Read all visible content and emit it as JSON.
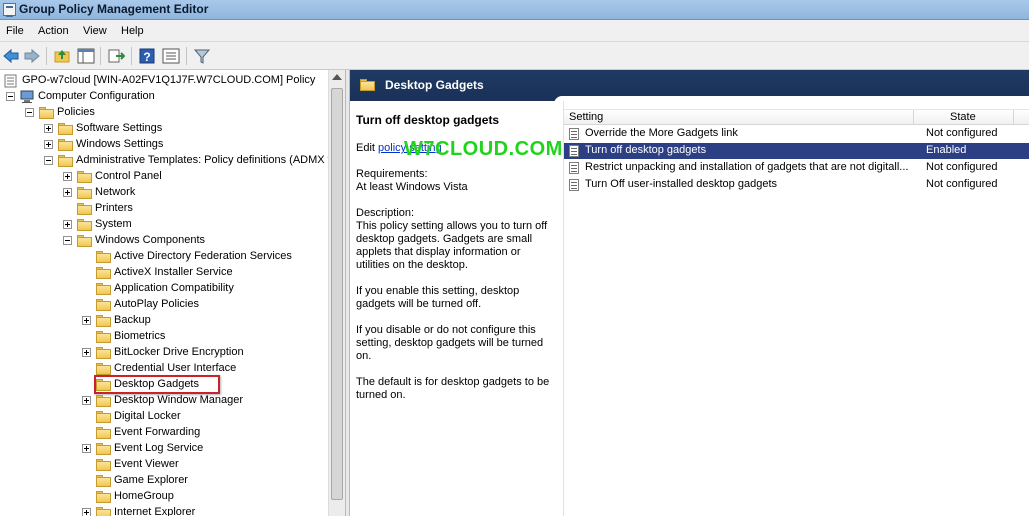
{
  "window": {
    "title": "Group Policy Management Editor"
  },
  "menu": [
    "File",
    "Action",
    "View",
    "Help"
  ],
  "toolbar": [
    "back-icon",
    "forward-icon",
    "up-folder-icon",
    "show-hide-tree-icon",
    "export-list-icon",
    "help-icon",
    "properties-icon",
    "filter-icon"
  ],
  "tree": {
    "items": [
      {
        "label": "GPO-w7cloud [WIN-A02FV1Q1J7F.W7CLOUD.COM] Policy",
        "expander": "none",
        "icon": "gpo-icon"
      },
      {
        "label": "Computer Configuration",
        "expander": "minus",
        "icon": "computer-icon"
      },
      {
        "label": "Policies",
        "expander": "minus",
        "icon": "folder-icon"
      },
      {
        "label": "Software Settings",
        "expander": "plus",
        "icon": "folder-icon"
      },
      {
        "label": "Windows Settings",
        "expander": "plus",
        "icon": "folder-icon"
      },
      {
        "label": "Administrative Templates: Policy definitions (ADMX fi",
        "expander": "minus",
        "icon": "folder-icon"
      },
      {
        "label": "Control Panel",
        "expander": "plus",
        "icon": "folder-icon"
      },
      {
        "label": "Network",
        "expander": "plus",
        "icon": "folder-icon"
      },
      {
        "label": "Printers",
        "expander": "none",
        "icon": "folder-icon"
      },
      {
        "label": "System",
        "expander": "plus",
        "icon": "folder-icon"
      },
      {
        "label": "Windows Components",
        "expander": "minus",
        "icon": "folder-icon"
      },
      {
        "label": "Active Directory Federation Services",
        "expander": "none",
        "icon": "folder-icon"
      },
      {
        "label": "ActiveX Installer Service",
        "expander": "none",
        "icon": "folder-icon"
      },
      {
        "label": "Application Compatibility",
        "expander": "none",
        "icon": "folder-icon"
      },
      {
        "label": "AutoPlay Policies",
        "expander": "none",
        "icon": "folder-icon"
      },
      {
        "label": "Backup",
        "expander": "plus",
        "icon": "folder-icon"
      },
      {
        "label": "Biometrics",
        "expander": "none",
        "icon": "folder-icon"
      },
      {
        "label": "BitLocker Drive Encryption",
        "expander": "plus",
        "icon": "folder-icon"
      },
      {
        "label": "Credential User Interface",
        "expander": "none",
        "icon": "folder-icon"
      },
      {
        "label": "Desktop Gadgets",
        "expander": "none",
        "icon": "folder-icon",
        "selected": true
      },
      {
        "label": "Desktop Window Manager",
        "expander": "plus",
        "icon": "folder-icon"
      },
      {
        "label": "Digital Locker",
        "expander": "none",
        "icon": "folder-icon"
      },
      {
        "label": "Event Forwarding",
        "expander": "none",
        "icon": "folder-icon"
      },
      {
        "label": "Event Log Service",
        "expander": "plus",
        "icon": "folder-icon"
      },
      {
        "label": "Event Viewer",
        "expander": "none",
        "icon": "folder-icon"
      },
      {
        "label": "Game Explorer",
        "expander": "none",
        "icon": "folder-icon"
      },
      {
        "label": "HomeGroup",
        "expander": "none",
        "icon": "folder-icon"
      },
      {
        "label": "Internet Explorer",
        "expander": "plus",
        "icon": "folder-icon"
      }
    ]
  },
  "right": {
    "header_title": "Desktop Gadgets",
    "description": {
      "title": "Turn off desktop gadgets",
      "edit_prefix": "Edit ",
      "edit_link": "policy setting",
      "requirements_label": "Requirements:",
      "requirements_value": "At least Windows Vista",
      "description_label": "Description:",
      "p1": "This policy setting allows you to turn off desktop gadgets. Gadgets are small applets that display information or utilities on the  desktop.",
      "p2": "If you enable this setting, desktop gadgets will be turned off.",
      "p3": "If you disable or do not configure this setting, desktop gadgets will be turned on.",
      "p4": "The default is for desktop gadgets to be turned on."
    },
    "watermark": "W7CLOUD.COM",
    "list": {
      "columns": {
        "setting": "Setting",
        "state": "State"
      },
      "rows": [
        {
          "name": "Override the More Gadgets link",
          "state": "Not configured",
          "selected": false
        },
        {
          "name": "Turn off desktop gadgets",
          "state": "Enabled",
          "selected": true
        },
        {
          "name": "Restrict unpacking and installation of gadgets that are not digitall...",
          "state": "Not configured",
          "selected": false
        },
        {
          "name": "Turn Off user-installed desktop gadgets",
          "state": "Not configured",
          "selected": false
        }
      ]
    }
  }
}
